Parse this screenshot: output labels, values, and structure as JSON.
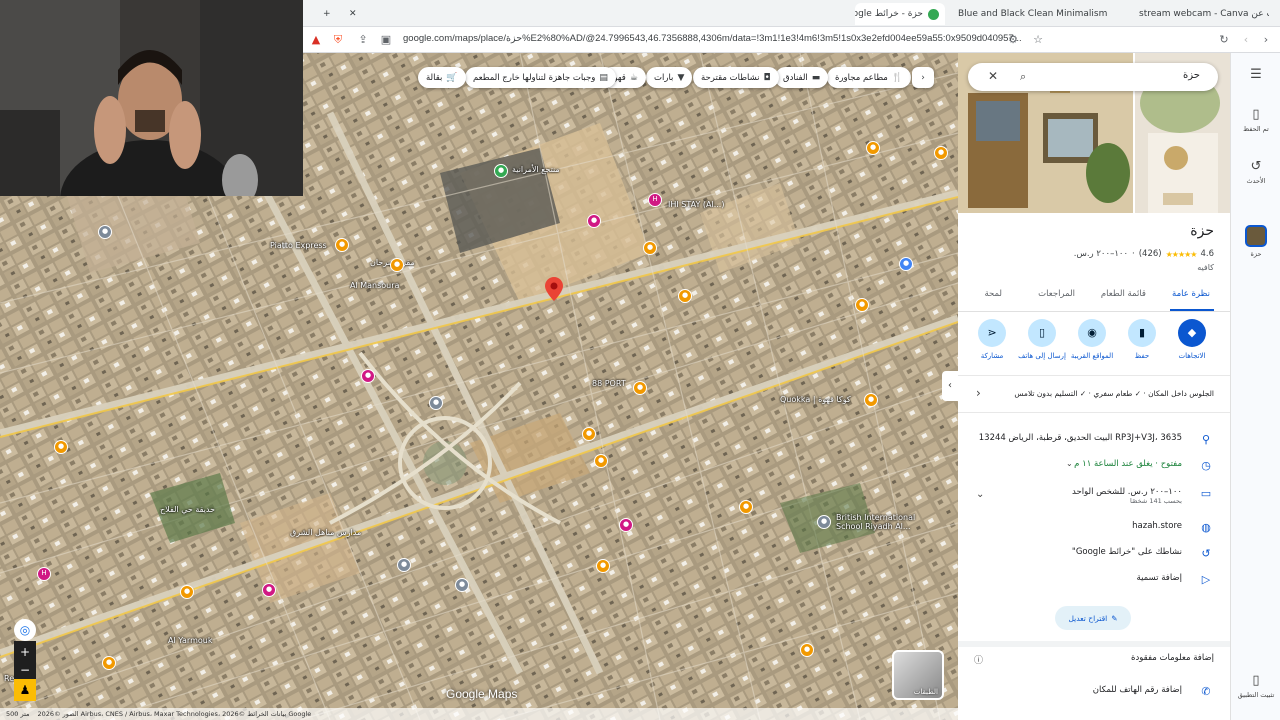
{
  "browser": {
    "tabs": [
      {
        "label": "حزة - خرائط Google",
        "favicon_color": "#34a853",
        "active": true
      },
      {
        "label": "Blue and Black Clean Minimalism Twi",
        "favicon_color": "#7d2ae8",
        "active": false
      },
      {
        "label": "stream webcam - Canva بحث عن",
        "favicon_color": "#4285f4",
        "active": false
      }
    ],
    "new_tab_symbol": "+",
    "close_symbol": "✕",
    "url": "google.com/maps/place/حزة%E2%80%AD/@24.7996543,46.7356888,4306m/data=!3m1!1e3!4m6!3m5!1s0x3e2efd004ee59a55:0x9509d040957..."
  },
  "map": {
    "category_chips": [
      {
        "label": "مطاعم مجاورة",
        "icon": "fork-knife-icon"
      },
      {
        "label": "الفنادق",
        "icon": "bed-icon"
      },
      {
        "label": "نشاطات مقترحة",
        "icon": "camera-icon"
      },
      {
        "label": "بارات",
        "icon": "cocktail-icon"
      },
      {
        "label": "قهوة",
        "icon": "coffee-icon"
      },
      {
        "label": "وجبات جاهزة لتناولها خارج المطعم",
        "icon": "takeout-icon"
      },
      {
        "label": "بقالة",
        "icon": "cart-icon"
      }
    ],
    "labels": [
      {
        "text": "Piatto Express"
      },
      {
        "text": "88 PORT"
      },
      {
        "text": "Quokka | كوكا قهوة"
      },
      {
        "text": "British International School Riyadh Al..."
      },
      {
        "text": "Al Mansoura"
      },
      {
        "text": "مقر السرحان"
      },
      {
        "text": "منتجع الأمرانية"
      },
      {
        "text": "Restafe"
      },
      {
        "text": "Al Yarmouk"
      },
      {
        "text": "حديقة حي الفلاح"
      },
      {
        "text": "مدارس مناهل الشرق"
      },
      {
        "text": "IHI STAY (Al...)"
      }
    ],
    "scale_label": "500 متر",
    "attribution": "الصور ©2026 Airbus، CNES / Airbus، Maxar Technologies، بيانات الخرائط ©2026 Google",
    "logo_text": "Google Maps",
    "layers_label": "الطبقات"
  },
  "panel": {
    "search_value": "حزة",
    "place_name": "حزة",
    "rating": "4.6",
    "stars": "★★★★★",
    "review_count": "(426)",
    "price": "١٠٠–٢٠٠ ر.س.",
    "category": "كافيه",
    "tabs": [
      "نظرة عامة",
      "قائمة الطعام",
      "المراجعات",
      "لمحة"
    ],
    "actions": [
      {
        "label": "الاتجاهات",
        "icon": "directions-icon"
      },
      {
        "label": "حفظ",
        "icon": "bookmark-icon"
      },
      {
        "label": "المواقع القريبة",
        "icon": "nearby-icon"
      },
      {
        "label": "إرسال إلى هاتف",
        "icon": "send-to-phone-icon"
      },
      {
        "label": "مشاركة",
        "icon": "share-icon"
      }
    ],
    "service_options": "الجلوس داخل المكان · ✓ طعام سفري · ✓ التسليم بدون تلامس",
    "address": "RP3J+V3J، 3635 البيت الحديق، قرطبة، الرياض 13244",
    "hours": "مفتوح · يغلق عند الساعة ١١ م",
    "price_per_person": "١٠٠–٢٠٠ ر.س. للشخص الواحد",
    "price_sub": "بحسب 141 شخصًا",
    "website": "hazah.store",
    "history": "نشاطك على \"خرائط Google\"",
    "add_label": "إضافة تسمية",
    "suggest_edit": "اقتراح تعديل",
    "add_missing": "إضافة معلومات مفقودة",
    "add_phone": "إضافة رقم الهاتف للمكان"
  },
  "rail": {
    "items": [
      "تم الحفظ",
      "الأحدث",
      "حزة",
      "تثبيت التطبيق"
    ]
  },
  "colors": {
    "accent": "#0b57d0",
    "pin_red": "#ea4335",
    "poi_orange": "#f29900",
    "poi_pink": "#d01884"
  }
}
